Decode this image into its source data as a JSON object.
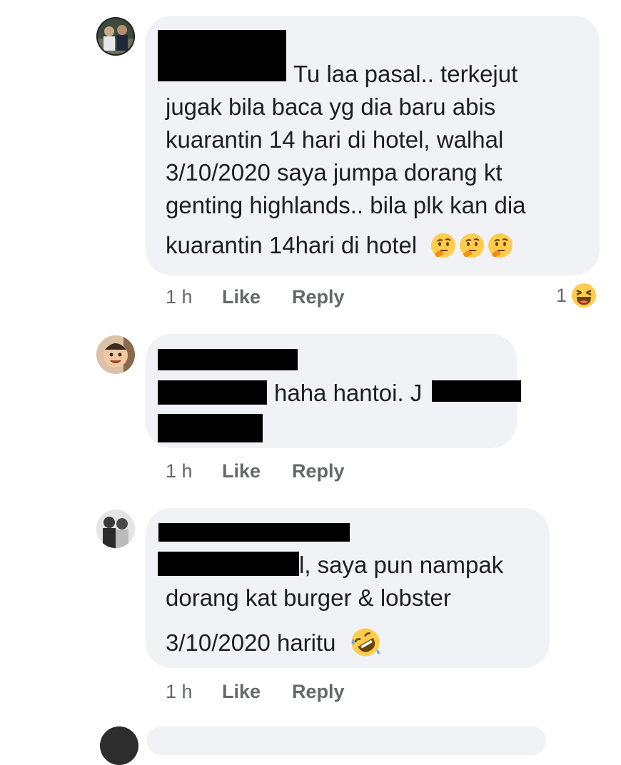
{
  "comments": [
    {
      "text_lines": [
        "Tu laa pasal.. terkejut",
        "jugak bila baca yg dia baru abis",
        "kuarantin 14 hari di hotel, walhal",
        "3/10/2020 saya jumpa dorang kt",
        "genting highlands.. bila plk kan dia",
        "kuarantin 14hari di hotel"
      ],
      "emojis": [
        "thinking-face-emoji",
        "thinking-face-emoji",
        "thinking-face-emoji"
      ],
      "time": "1 h",
      "like_label": "Like",
      "reply_label": "Reply",
      "reaction_count": "1",
      "reaction_icon": "haha-reaction-icon"
    },
    {
      "text_lines": [
        "haha hantoi. J"
      ],
      "time": "1 h",
      "like_label": "Like",
      "reply_label": "Reply"
    },
    {
      "text_lines": [
        "l, saya pun nampak",
        "dorang kat burger & lobster",
        "3/10/2020 haritu"
      ],
      "emojis": [
        "rolling-on-floor-laughing-emoji"
      ],
      "time": "1 h",
      "like_label": "Like",
      "reply_label": "Reply"
    }
  ],
  "colors": {
    "bubble": "#f0f2f5",
    "text": "#1c1e21",
    "meta": "#65676b",
    "redaction": "#000000",
    "emoji_yellow": "#ffcc4d"
  }
}
